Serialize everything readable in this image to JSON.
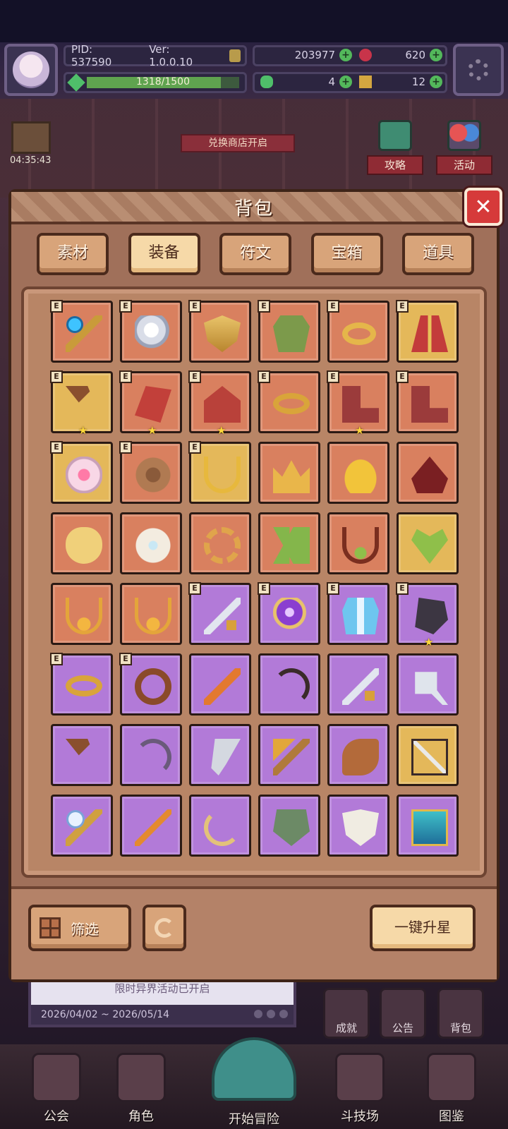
{
  "hud": {
    "pid": "PID: 537590",
    "version": "Ver: 1.0.0.10",
    "exp_text": "1318/1500",
    "exp_progress": 0.879,
    "currency_1": "203977",
    "currency_2": "620",
    "currency_3": "4",
    "currency_4": "12"
  },
  "side": {
    "gift_timer": "04:35:43",
    "exchange_banner": "兑换商店开启",
    "strategy": "攻略",
    "event": "活动"
  },
  "bag": {
    "title": "背包",
    "close": "✕",
    "tabs": [
      {
        "label": "素材"
      },
      {
        "label": "装备"
      },
      {
        "label": "符文"
      },
      {
        "label": "宝箱"
      },
      {
        "label": "道具"
      }
    ],
    "active_tab": 1,
    "badge": "E",
    "star": "★",
    "items": [
      {
        "name": "staff",
        "rarity": "orange",
        "e": true,
        "star": false
      },
      {
        "name": "orb",
        "rarity": "orange",
        "e": true,
        "star": false
      },
      {
        "name": "shield",
        "rarity": "orange",
        "e": true,
        "star": false
      },
      {
        "name": "armor-g",
        "rarity": "orange",
        "e": true,
        "star": false
      },
      {
        "name": "ring",
        "rarity": "orange",
        "e": true,
        "star": false
      },
      {
        "name": "robe",
        "rarity": "gold",
        "e": true,
        "star": false
      },
      {
        "name": "club",
        "rarity": "gold",
        "e": true,
        "star": true
      },
      {
        "name": "gauntlet",
        "rarity": "orange",
        "e": true,
        "star": true
      },
      {
        "name": "helm-red",
        "rarity": "orange",
        "e": true,
        "star": true
      },
      {
        "name": "bracelet",
        "rarity": "orange",
        "e": true,
        "star": false
      },
      {
        "name": "boots",
        "rarity": "orange",
        "e": true,
        "star": true
      },
      {
        "name": "boots",
        "rarity": "orange",
        "e": true,
        "star": false
      },
      {
        "name": "pink",
        "rarity": "gold",
        "e": true,
        "star": false
      },
      {
        "name": "cookie",
        "rarity": "orange",
        "e": true,
        "star": false
      },
      {
        "name": "necklace",
        "rarity": "gold",
        "e": true,
        "star": false
      },
      {
        "name": "crown",
        "rarity": "orange",
        "e": false,
        "star": false
      },
      {
        "name": "gold-hat",
        "rarity": "orange",
        "e": false,
        "star": false
      },
      {
        "name": "hood",
        "rarity": "orange",
        "e": false,
        "star": false
      },
      {
        "name": "mask",
        "rarity": "orange",
        "e": false,
        "star": false
      },
      {
        "name": "wings",
        "rarity": "orange",
        "e": false,
        "star": false
      },
      {
        "name": "gear",
        "rarity": "orange",
        "e": false,
        "star": false
      },
      {
        "name": "green-boots",
        "rarity": "orange",
        "e": false,
        "star": false
      },
      {
        "name": "heart-neck",
        "rarity": "orange",
        "e": false,
        "star": false
      },
      {
        "name": "heart-green",
        "rarity": "gold",
        "e": false,
        "star": false
      },
      {
        "name": "pendant",
        "rarity": "orange",
        "e": false,
        "star": false
      },
      {
        "name": "pendant",
        "rarity": "orange",
        "e": false,
        "star": false
      },
      {
        "name": "sword",
        "rarity": "purple",
        "e": true,
        "star": false
      },
      {
        "name": "purple-orb",
        "rarity": "purple",
        "e": true,
        "star": false
      },
      {
        "name": "blue-armor",
        "rarity": "purple",
        "e": true,
        "star": false
      },
      {
        "name": "glove",
        "rarity": "purple",
        "e": true,
        "star": true
      },
      {
        "name": "bracelet",
        "rarity": "purple",
        "e": true,
        "star": false
      },
      {
        "name": "ring-brown",
        "rarity": "purple",
        "e": true,
        "star": false
      },
      {
        "name": "orange-sword",
        "rarity": "purple",
        "e": false,
        "star": false
      },
      {
        "name": "bow",
        "rarity": "purple",
        "e": false,
        "star": false
      },
      {
        "name": "sword",
        "rarity": "purple",
        "e": false,
        "star": false
      },
      {
        "name": "cleaver",
        "rarity": "purple",
        "e": false,
        "star": false
      },
      {
        "name": "club",
        "rarity": "purple",
        "e": false,
        "star": false
      },
      {
        "name": "bow2",
        "rarity": "purple",
        "e": false,
        "star": false
      },
      {
        "name": "blade",
        "rarity": "purple",
        "e": false,
        "star": false
      },
      {
        "name": "mace",
        "rarity": "purple",
        "e": false,
        "star": false
      },
      {
        "name": "horn",
        "rarity": "purple",
        "e": false,
        "star": false
      },
      {
        "name": "crossbow",
        "rarity": "gold",
        "e": false,
        "star": false
      },
      {
        "name": "wand",
        "rarity": "purple",
        "e": false,
        "star": false
      },
      {
        "name": "dagger",
        "rarity": "purple",
        "e": false,
        "star": false
      },
      {
        "name": "sickle",
        "rarity": "purple",
        "e": false,
        "star": false
      },
      {
        "name": "green-shield",
        "rarity": "purple",
        "e": false,
        "star": false
      },
      {
        "name": "white-shield",
        "rarity": "purple",
        "e": false,
        "star": false
      },
      {
        "name": "tome",
        "rarity": "purple",
        "e": false,
        "star": false
      }
    ],
    "filter": "筛选",
    "star_up": "一键升星"
  },
  "event_banner": {
    "title": "限时异界活动已开启",
    "dates": "2026/04/02 ~ 2026/05/14"
  },
  "mini": {
    "achieve": "成就",
    "notice": "公告",
    "bag": "背包"
  },
  "nav": {
    "guild": "公会",
    "role": "角色",
    "start": "开始冒险",
    "arena": "斗技场",
    "codex": "图鉴"
  }
}
